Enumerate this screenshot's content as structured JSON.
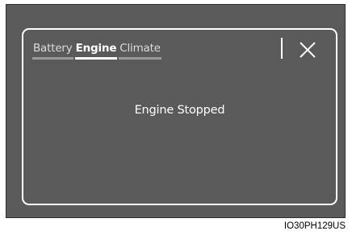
{
  "tabs": [
    {
      "label": "Battery",
      "active": false
    },
    {
      "label": "Engine",
      "active": true
    },
    {
      "label": "Climate",
      "active": false
    }
  ],
  "status": {
    "message": "Engine Stopped"
  },
  "close_icon": "close-icon",
  "figure_code": "IO30PH129US",
  "colors": {
    "background": "#5a5a5a",
    "border": "#ffffff",
    "tab_active_underline": "#ffffff",
    "tab_inactive_underline": "#9a9a9a"
  }
}
